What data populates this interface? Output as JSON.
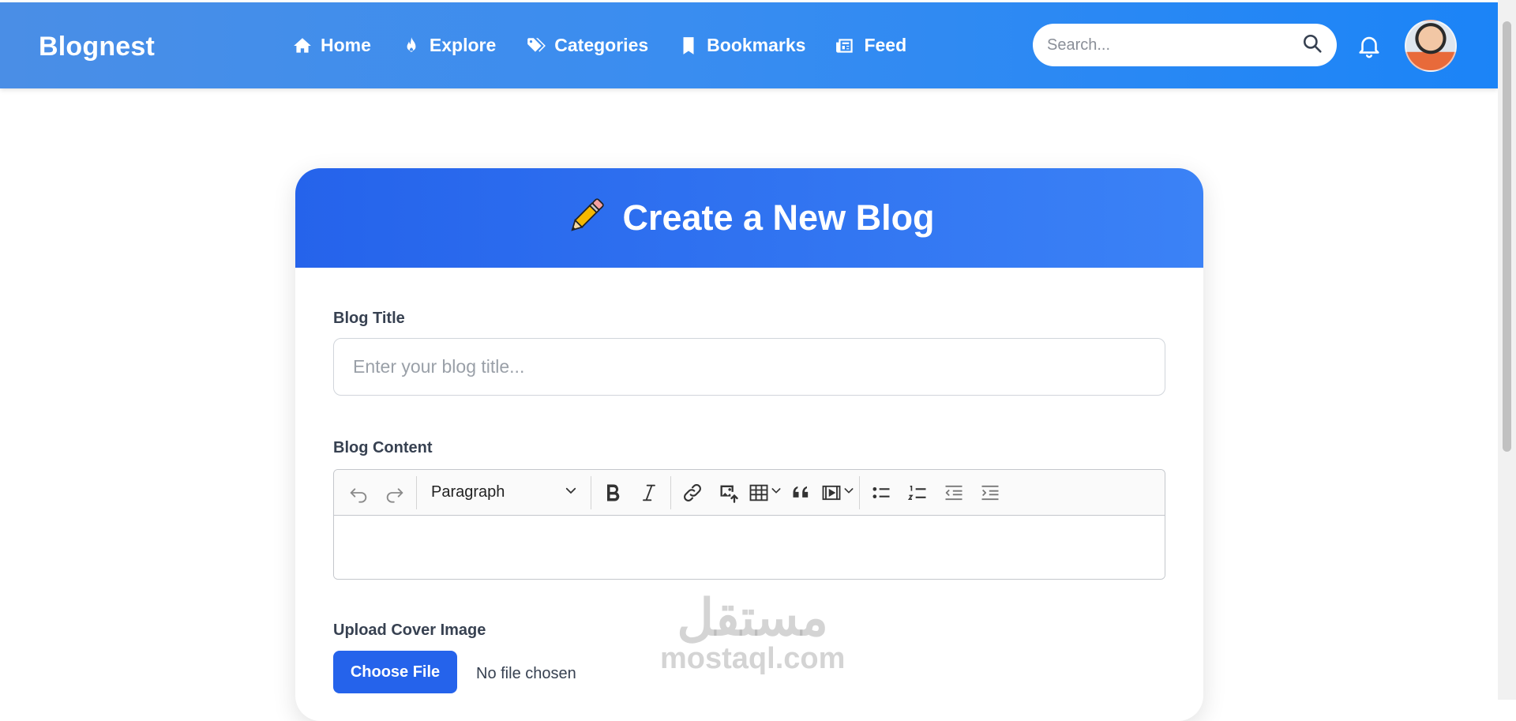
{
  "navbar": {
    "brand": "Blognest",
    "links": [
      {
        "label": "Home",
        "icon": "home-icon"
      },
      {
        "label": "Explore",
        "icon": "fire-icon"
      },
      {
        "label": "Categories",
        "icon": "tags-icon"
      },
      {
        "label": "Bookmarks",
        "icon": "bookmark-icon"
      },
      {
        "label": "Feed",
        "icon": "newspaper-icon"
      }
    ],
    "search_placeholder": "Search...",
    "bell_icon": "bell-icon",
    "avatar_icon": "user-avatar"
  },
  "card": {
    "title": "Create a New Blog",
    "title_icon": "pencil-icon"
  },
  "form": {
    "title_label": "Blog Title",
    "title_placeholder": "Enter your blog title...",
    "content_label": "Blog Content",
    "editor": {
      "paragraph_style": "Paragraph",
      "tools": [
        "undo-icon",
        "redo-icon",
        "bold-icon",
        "italic-icon",
        "link-icon",
        "image-upload-icon",
        "table-icon",
        "blockquote-icon",
        "media-embed-icon",
        "bulleted-list-icon",
        "numbered-list-icon",
        "outdent-icon",
        "indent-icon"
      ]
    },
    "upload_label": "Upload Cover Image",
    "choose_file_label": "Choose File",
    "no_file_text": "No file chosen"
  },
  "watermark": {
    "logo_text": "مستقل",
    "site": "mostaql.com"
  },
  "colors": {
    "navbar_start": "#4a8ee6",
    "navbar_end": "#1b84f7",
    "card_header_start": "#2563eb",
    "card_header_end": "#3b82f6",
    "primary_button": "#2563eb"
  }
}
